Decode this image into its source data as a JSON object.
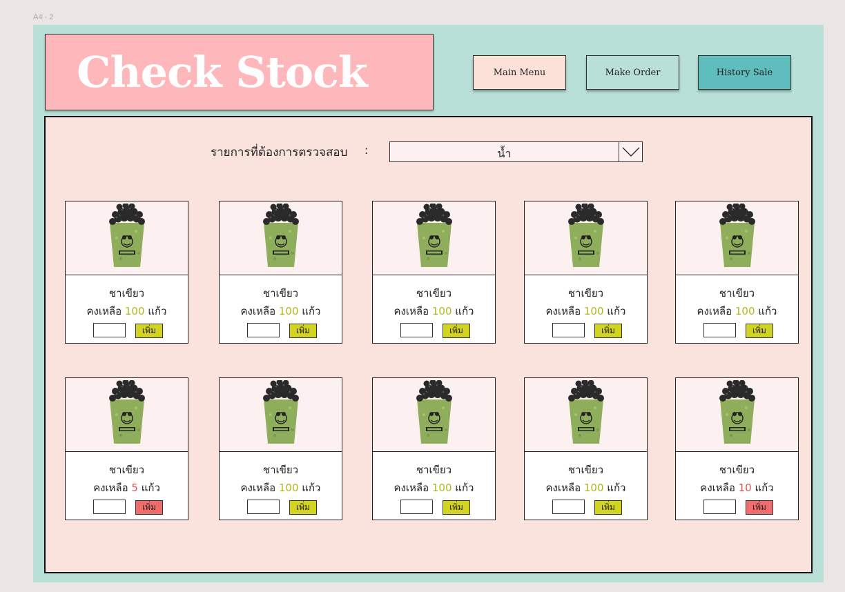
{
  "frame_label": "A4 - 2",
  "header": {
    "title": "Check Stock",
    "nav": {
      "main_menu": "Main Menu",
      "make_order": "Make Order",
      "history_sale": "History Sale"
    }
  },
  "filter": {
    "label": "รายการที่ต้องการตรวจสอบ",
    "colon": ":",
    "selected": "น้ำ"
  },
  "colors": {
    "frame_bg": "#b9e0d8",
    "title_bg": "#feb7ba",
    "panel_bg": "#fae3dc",
    "history_btn": "#5fbdbd",
    "ok_value": "#b5b61a",
    "low_value": "#e05050",
    "add_ok": "#d3d324",
    "add_low": "#f06c6c"
  },
  "stock_prefix": "คงเหลือ",
  "stock_unit": "แก้ว",
  "products": [
    {
      "name": "ชาเขียว",
      "remaining": "100",
      "low": false,
      "add_label": "เพิ่ม",
      "image_icon": "green-tea-cup-icon"
    },
    {
      "name": "ชาเขียว",
      "remaining": "100",
      "low": false,
      "add_label": "เพิ่ม",
      "image_icon": "green-tea-cup-icon"
    },
    {
      "name": "ชาเขียว",
      "remaining": "100",
      "low": false,
      "add_label": "เพิ่ม",
      "image_icon": "green-tea-cup-icon"
    },
    {
      "name": "ชาเขียว",
      "remaining": "100",
      "low": false,
      "add_label": "เพิ่ม",
      "image_icon": "green-tea-cup-icon"
    },
    {
      "name": "ชาเขียว",
      "remaining": "100",
      "low": false,
      "add_label": "เพิ่ม",
      "image_icon": "green-tea-cup-icon"
    },
    {
      "name": "ชาเขียว",
      "remaining": "5",
      "low": true,
      "add_label": "เพิ่ม",
      "image_icon": "green-tea-cup-icon"
    },
    {
      "name": "ชาเขียว",
      "remaining": "100",
      "low": false,
      "add_label": "เพิ่ม",
      "image_icon": "green-tea-cup-icon"
    },
    {
      "name": "ชาเขียว",
      "remaining": "100",
      "low": false,
      "add_label": "เพิ่ม",
      "image_icon": "green-tea-cup-icon"
    },
    {
      "name": "ชาเขียว",
      "remaining": "100",
      "low": false,
      "add_label": "เพิ่ม",
      "image_icon": "green-tea-cup-icon"
    },
    {
      "name": "ชาเขียว",
      "remaining": "10",
      "low": true,
      "add_label": "เพิ่ม",
      "image_icon": "green-tea-cup-icon"
    }
  ]
}
